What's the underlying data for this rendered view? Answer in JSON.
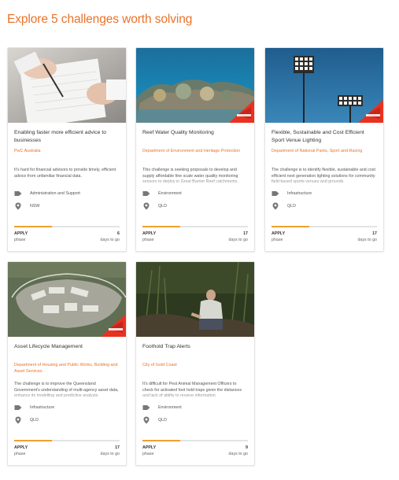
{
  "page": {
    "heading": "Explore 5 challenges worth solving"
  },
  "colors": {
    "accent": "#e8732a",
    "progress": "#f0a030",
    "track": "#e3e3e3",
    "icon": "#777777"
  },
  "icons": {
    "category": "tag-icon",
    "location": "map-pin-icon"
  },
  "cards": [
    {
      "title": "Enabling faster more efficient advice to businesses",
      "organisation": "PwC Australia",
      "description": "It's hard for financial advisors to provide timely, efficient advice from unfamiliar financial data.",
      "category": "Administration and Support",
      "location": "NSW",
      "phase": "APPLY",
      "phase_label": "phase",
      "days": "6",
      "days_label": "days to go",
      "progress": 0.36,
      "image": "person writing on notepad at desk",
      "badge": false
    },
    {
      "title": "Reef Water Quality Monitoring",
      "organisation": "Department of Environment and Heritage Protection",
      "description": "This challenge is seeking proposals to develop and supply affordable fine scale water quality monitoring sensors to deploy in Great Barrier Reef catchments.",
      "category": "Environment",
      "location": "QLD",
      "phase": "APPLY",
      "phase_label": "phase",
      "days": "17",
      "days_label": "days to go",
      "progress": 0.36,
      "image": "coral reef underwater",
      "badge": true
    },
    {
      "title": "Flexible, Sustainable and Cost Efficient Sport Venue Lighting",
      "organisation": "Department of National Parks, Sport and Racing",
      "description": "The challenge is to identify flexible, sustainable and cost efficient next generation lighting solutions for community field-based sports venues and grounds.",
      "category": "Infrastructure",
      "location": "QLD",
      "phase": "APPLY",
      "phase_label": "phase",
      "days": "17",
      "days_label": "days to go",
      "progress": 0.36,
      "image": "stadium floodlights against sky",
      "badge": true
    },
    {
      "title": "Asset Lifecycle Management",
      "organisation": "Department of Housing and Public Works, Building and Asset Services",
      "description": "The challenge is to improve the Queensland Government's understanding of multi-agency asset data, enhance its modelling and predictive analysis.",
      "category": "Infrastructure",
      "location": "QLD",
      "phase": "APPLY",
      "phase_label": "phase",
      "days": "17",
      "days_label": "days to go",
      "progress": 0.36,
      "image": "aerial view of facility complex",
      "badge": true
    },
    {
      "title": "Foothold Trap Alerts",
      "organisation": "City of Gold Coast",
      "description": "It's difficult for Pest Animal Management Officers to check for activated foot hold traps given the distances and lack of ability to receive information.",
      "category": "Environment",
      "location": "QLD",
      "phase": "APPLY",
      "phase_label": "phase",
      "days": "9",
      "days_label": "days to go",
      "progress": 0.36,
      "image": "person crouching in bushland",
      "badge": false
    }
  ]
}
